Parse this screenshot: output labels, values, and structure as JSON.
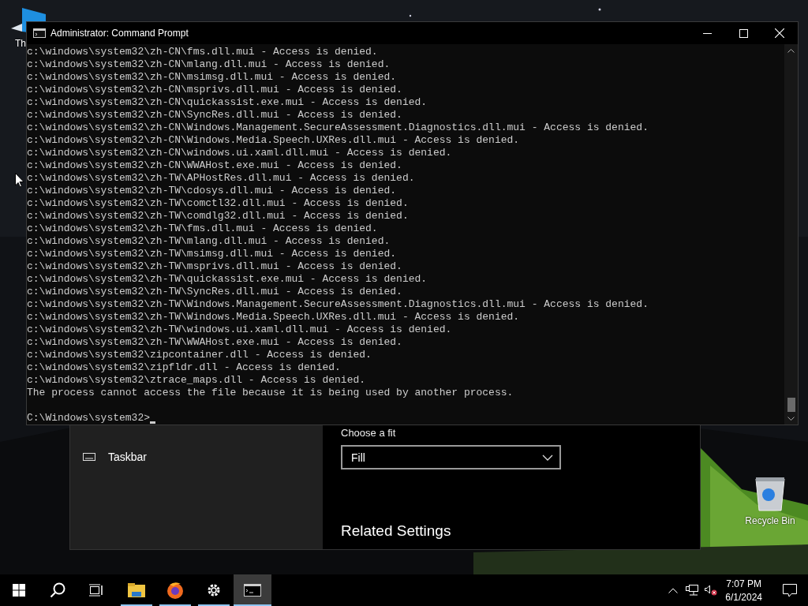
{
  "desktop_icons": [
    {
      "kind": "folder",
      "label": "Th"
    },
    {
      "kind": "recycle",
      "label": "Recycle Bin"
    }
  ],
  "settings_window": {
    "sidebar_items": [
      {
        "label": "Taskbar"
      }
    ],
    "fit_label": "Choose a fit",
    "fit_dropdown": {
      "value": "Fill"
    },
    "related_heading": "Related Settings"
  },
  "cmd_window": {
    "title": "Administrator: Command Prompt",
    "lines": [
      "c:\\windows\\system32\\zh-CN\\fms.dll.mui - Access is denied.",
      "c:\\windows\\system32\\zh-CN\\mlang.dll.mui - Access is denied.",
      "c:\\windows\\system32\\zh-CN\\msimsg.dll.mui - Access is denied.",
      "c:\\windows\\system32\\zh-CN\\msprivs.dll.mui - Access is denied.",
      "c:\\windows\\system32\\zh-CN\\quickassist.exe.mui - Access is denied.",
      "c:\\windows\\system32\\zh-CN\\SyncRes.dll.mui - Access is denied.",
      "c:\\windows\\system32\\zh-CN\\Windows.Management.SecureAssessment.Diagnostics.dll.mui - Access is denied.",
      "c:\\windows\\system32\\zh-CN\\Windows.Media.Speech.UXRes.dll.mui - Access is denied.",
      "c:\\windows\\system32\\zh-CN\\windows.ui.xaml.dll.mui - Access is denied.",
      "c:\\windows\\system32\\zh-CN\\WWAHost.exe.mui - Access is denied.",
      "c:\\windows\\system32\\zh-TW\\APHostRes.dll.mui - Access is denied.",
      "c:\\windows\\system32\\zh-TW\\cdosys.dll.mui - Access is denied.",
      "c:\\windows\\system32\\zh-TW\\comctl32.dll.mui - Access is denied.",
      "c:\\windows\\system32\\zh-TW\\comdlg32.dll.mui - Access is denied.",
      "c:\\windows\\system32\\zh-TW\\fms.dll.mui - Access is denied.",
      "c:\\windows\\system32\\zh-TW\\mlang.dll.mui - Access is denied.",
      "c:\\windows\\system32\\zh-TW\\msimsg.dll.mui - Access is denied.",
      "c:\\windows\\system32\\zh-TW\\msprivs.dll.mui - Access is denied.",
      "c:\\windows\\system32\\zh-TW\\quickassist.exe.mui - Access is denied.",
      "c:\\windows\\system32\\zh-TW\\SyncRes.dll.mui - Access is denied.",
      "c:\\windows\\system32\\zh-TW\\Windows.Management.SecureAssessment.Diagnostics.dll.mui - Access is denied.",
      "c:\\windows\\system32\\zh-TW\\Windows.Media.Speech.UXRes.dll.mui - Access is denied.",
      "c:\\windows\\system32\\zh-TW\\windows.ui.xaml.dll.mui - Access is denied.",
      "c:\\windows\\system32\\zh-TW\\WWAHost.exe.mui - Access is denied.",
      "c:\\windows\\system32\\zipcontainer.dll - Access is denied.",
      "c:\\windows\\system32\\zipfldr.dll - Access is denied.",
      "c:\\windows\\system32\\ztrace_maps.dll - Access is denied.",
      "The process cannot access the file because it is being used by another process."
    ],
    "prompt": "C:\\Windows\\system32>"
  },
  "taskbar": {
    "buttons": [
      {
        "kind": "start",
        "running": false,
        "selected": false
      },
      {
        "kind": "search",
        "running": false,
        "selected": false
      },
      {
        "kind": "taskview",
        "running": false,
        "selected": false
      },
      {
        "kind": "explorer",
        "running": true,
        "selected": false
      },
      {
        "kind": "firefox",
        "running": true,
        "selected": false
      },
      {
        "kind": "settings",
        "running": true,
        "selected": false
      },
      {
        "kind": "cmd",
        "running": true,
        "selected": true
      }
    ],
    "clock": {
      "time": "7:07 PM",
      "date": "6/1/2024"
    }
  }
}
